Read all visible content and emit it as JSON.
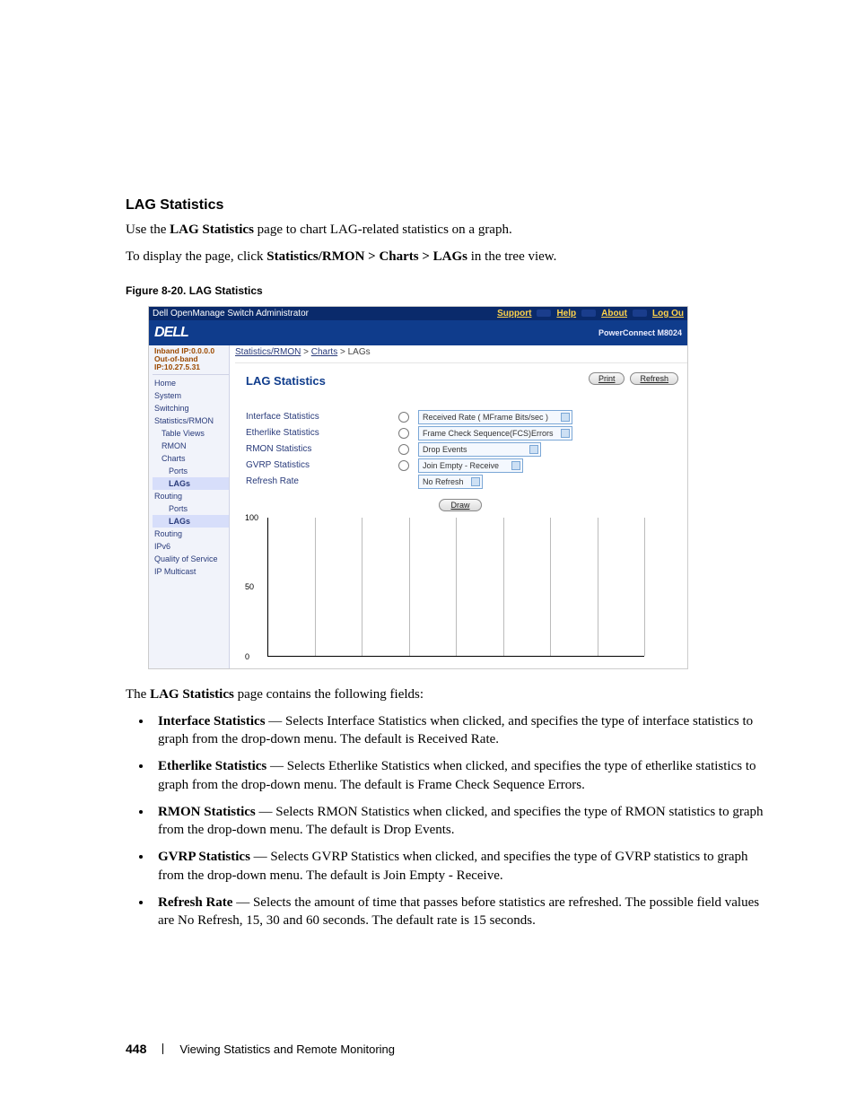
{
  "doc": {
    "heading": "LAG Statistics",
    "intro1_a": "Use the ",
    "intro1_b": "LAG Statistics",
    "intro1_c": " page to chart LAG-related statistics on a graph.",
    "intro2_a": "To display the page, click ",
    "intro2_b": "Statistics/RMON > Charts > LAGs",
    "intro2_c": " in the tree view.",
    "figure_caption": "Figure 8-20.    LAG Statistics",
    "after_shot": "The ",
    "after_shot_b": "LAG Statistics",
    "after_shot_c": " page contains the following fields:",
    "bullets": [
      {
        "term": "Interface Statistics",
        "text": " — Selects Interface Statistics when clicked, and specifies the type of interface statistics to graph from the drop-down menu. The default is Received Rate."
      },
      {
        "term": "Etherlike Statistics",
        "text": " — Selects Etherlike Statistics when clicked, and specifies the type of etherlike statistics to graph from the drop-down menu. The default is Frame Check Sequence Errors."
      },
      {
        "term": "RMON Statistics",
        "text": " — Selects RMON Statistics when clicked, and specifies the type of RMON statistics to graph from the drop-down menu. The default is Drop Events."
      },
      {
        "term": "GVRP Statistics",
        "text": " — Selects GVRP Statistics when clicked, and specifies the type of GVRP statistics to graph from the drop-down menu. The default is Join Empty - Receive."
      },
      {
        "term": "Refresh Rate",
        "text": " — Selects the amount of time that passes before statistics are refreshed. The possible field values are No Refresh, 15, 30 and 60 seconds. The default rate is 15 seconds."
      }
    ],
    "page_number": "448",
    "footer_text": "Viewing Statistics and Remote Monitoring"
  },
  "ui": {
    "titlebar_left": "Dell OpenManage Switch Administrator",
    "titlebar_links": [
      "Support",
      "Help",
      "About",
      "Log Ou"
    ],
    "brand_logo": "DELL",
    "product": "PowerConnect M8024",
    "ip_line1": "Inband IP:0.0.0.0",
    "ip_line2": "Out-of-band IP:10.27.5.31",
    "tree": [
      {
        "t": "Home",
        "ind": 0,
        "sel": false
      },
      {
        "t": "System",
        "ind": 0,
        "sel": false
      },
      {
        "t": "Switching",
        "ind": 0,
        "sel": false
      },
      {
        "t": "Statistics/RMON",
        "ind": 0,
        "sel": false
      },
      {
        "t": "Table Views",
        "ind": 1,
        "sel": false
      },
      {
        "t": "RMON",
        "ind": 1,
        "sel": false
      },
      {
        "t": "Charts",
        "ind": 1,
        "sel": false
      },
      {
        "t": "Ports",
        "ind": 2,
        "sel": false
      },
      {
        "t": "LAGs",
        "ind": 2,
        "sel": true
      },
      {
        "t": "Routing",
        "ind": 0,
        "sel": false
      },
      {
        "t": "Ports",
        "ind": 2,
        "sel": false
      },
      {
        "t": "LAGs",
        "ind": 2,
        "sel": true
      },
      {
        "t": "Routing",
        "ind": 0,
        "sel": false
      },
      {
        "t": "IPv6",
        "ind": 0,
        "sel": false
      },
      {
        "t": "Quality of Service",
        "ind": 0,
        "sel": false
      },
      {
        "t": "IP Multicast",
        "ind": 0,
        "sel": false
      }
    ],
    "breadcrumb": {
      "a": "Statistics/RMON",
      "b": "Charts",
      "c": "LAGs"
    },
    "panel_title": "LAG Statistics",
    "btn_print": "Print",
    "btn_refresh": "Refresh",
    "rows": [
      {
        "label": "Interface Statistics",
        "select": "Received Rate ( MFrame Bits/sec )"
      },
      {
        "label": "Etherlike Statistics",
        "select": "Frame Check Sequence(FCS)Errors"
      },
      {
        "label": "RMON Statistics",
        "select": "Drop Events"
      },
      {
        "label": "GVRP Statistics",
        "select": "Join Empty - Receive"
      },
      {
        "label": "Refresh Rate",
        "select": "No Refresh"
      }
    ],
    "draw": "Draw"
  },
  "chart_data": {
    "type": "bar",
    "categories": [],
    "values": [],
    "title": "",
    "xlabel": "",
    "ylabel": "",
    "ylim": [
      0,
      100
    ],
    "yticks": [
      0,
      50,
      100
    ],
    "vertical_gridlines": 8
  }
}
